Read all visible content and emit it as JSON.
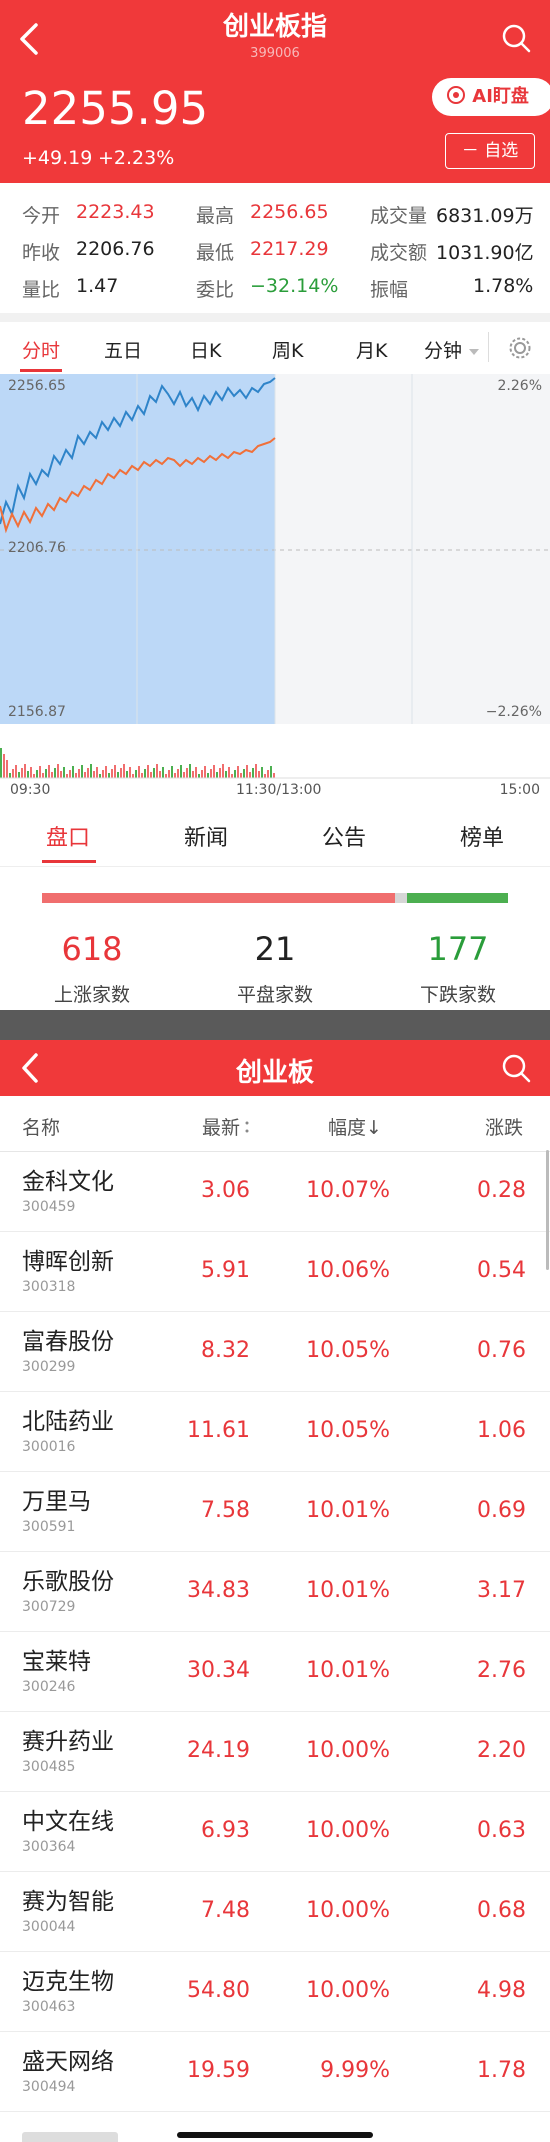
{
  "header": {
    "title": "创业板指",
    "code": "399006",
    "price": "2255.95",
    "change": "+49.19",
    "change_pct": "+2.23%",
    "ai_button": "AI盯盘",
    "watch_button": "－ 自选"
  },
  "quote": {
    "open_label": "今开",
    "open": "2223.43",
    "high_label": "最高",
    "high": "2256.65",
    "volume_label": "成交量",
    "volume": "6831.09万",
    "prev_close_label": "昨收",
    "prev_close": "2206.76",
    "low_label": "最低",
    "low": "2217.29",
    "amount_label": "成交额",
    "amount": "1031.90亿",
    "vol_ratio_label": "量比",
    "vol_ratio": "1.47",
    "bid_ratio_label": "委比",
    "bid_ratio": "−32.14%",
    "amplitude_label": "振幅",
    "amplitude": "1.78%"
  },
  "chart_tabs": [
    "分时",
    "五日",
    "日K",
    "周K",
    "月K",
    "分钟"
  ],
  "chart": {
    "price_top": "2256.65",
    "price_mid": "2206.76",
    "price_bottom": "2156.87",
    "pct_top": "2.26%",
    "pct_bottom": "−2.26%",
    "time_start": "09:30",
    "time_mid": "11:30/13:00",
    "time_end": "15:00",
    "line_color": "#2f84c9",
    "avg_color": "#f0703a",
    "fill_color": "#bcd8f7"
  },
  "detail_tabs": [
    "盘口",
    "新闻",
    "公告",
    "榜单"
  ],
  "breadth": {
    "up": "618",
    "up_label": "上涨家数",
    "up_fraction": 0.759,
    "flat": "21",
    "flat_label": "平盘家数",
    "flat_fraction": 0.026,
    "down": "177",
    "down_label": "下跌家数",
    "down_fraction": 0.217
  },
  "board": {
    "title": "创业板"
  },
  "list_header": {
    "name": "名称",
    "latest": "最新",
    "amplitude": "幅度↓",
    "change": "涨跌"
  },
  "rows": [
    {
      "name": "金科文化",
      "code": "300459",
      "price": "3.06",
      "pct": "10.07%",
      "chg": "0.28"
    },
    {
      "name": "博晖创新",
      "code": "300318",
      "price": "5.91",
      "pct": "10.06%",
      "chg": "0.54"
    },
    {
      "name": "富春股份",
      "code": "300299",
      "price": "8.32",
      "pct": "10.05%",
      "chg": "0.76"
    },
    {
      "name": "北陆药业",
      "code": "300016",
      "price": "11.61",
      "pct": "10.05%",
      "chg": "1.06"
    },
    {
      "name": "万里马",
      "code": "300591",
      "price": "7.58",
      "pct": "10.01%",
      "chg": "0.69"
    },
    {
      "name": "乐歌股份",
      "code": "300729",
      "price": "34.83",
      "pct": "10.01%",
      "chg": "3.17"
    },
    {
      "name": "宝莱特",
      "code": "300246",
      "price": "30.34",
      "pct": "10.01%",
      "chg": "2.76"
    },
    {
      "name": "赛升药业",
      "code": "300485",
      "price": "24.19",
      "pct": "10.00%",
      "chg": "2.20"
    },
    {
      "name": "中文在线",
      "code": "300364",
      "price": "6.93",
      "pct": "10.00%",
      "chg": "0.63"
    },
    {
      "name": "赛为智能",
      "code": "300044",
      "price": "7.48",
      "pct": "10.00%",
      "chg": "0.68"
    },
    {
      "name": "迈克生物",
      "code": "300463",
      "price": "54.80",
      "pct": "10.00%",
      "chg": "4.98"
    },
    {
      "name": "盛天网络",
      "code": "300494",
      "price": "19.59",
      "pct": "9.99%",
      "chg": "1.78"
    }
  ]
}
